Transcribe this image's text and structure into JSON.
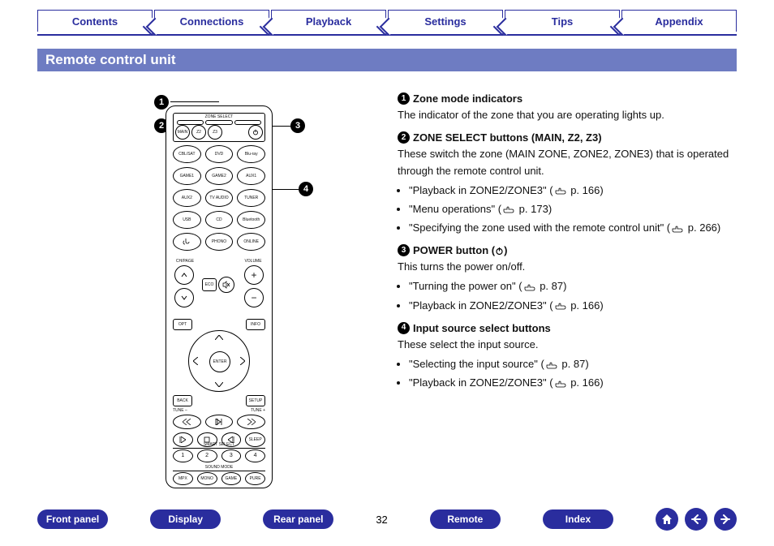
{
  "tabs": [
    "Contents",
    "Connections",
    "Playback",
    "Settings",
    "Tips",
    "Appendix"
  ],
  "title": "Remote control unit",
  "callouts": {
    "c1": "1",
    "c2": "2",
    "c3": "3",
    "c4": "4"
  },
  "sections": [
    {
      "num": "1",
      "heading": "Zone mode indicators",
      "body": "The indicator of the zone that you are operating lights up.",
      "links": []
    },
    {
      "num": "2",
      "heading": "ZONE SELECT buttons (MAIN, Z2, Z3)",
      "body": "These switch the zone (MAIN ZONE, ZONE2, ZONE3) that is operated through the remote control unit.",
      "links": [
        {
          "label": "\"Playback in ZONE2/ZONE3\"",
          "page": "p. 166"
        },
        {
          "label": "\"Menu operations\"",
          "page": "p. 173"
        },
        {
          "label": "\"Specifying the zone used with the remote control unit\"",
          "page": "p. 266"
        }
      ]
    },
    {
      "num": "3",
      "heading": "POWER button (",
      "heading_after": ")",
      "body": "This turns the power on/off.",
      "links": [
        {
          "label": "\"Turning the power on\"",
          "page": "p. 87"
        },
        {
          "label": "\"Playback in ZONE2/ZONE3\"",
          "page": "p. 166"
        }
      ]
    },
    {
      "num": "4",
      "heading": "Input source select buttons",
      "body": "These select the input source.",
      "links": [
        {
          "label": "\"Selecting the input source\"",
          "page": "p. 87"
        },
        {
          "label": "\"Playback in ZONE2/ZONE3\"",
          "page": "p. 166"
        }
      ]
    }
  ],
  "bottom_buttons": [
    "Front panel",
    "Display",
    "Rear panel"
  ],
  "page_number": "32",
  "bottom_buttons2": [
    "Remote",
    "Index"
  ],
  "remote_labels": {
    "zone_select": "ZONE SELECT",
    "main": "MAIN",
    "z2": "Z2",
    "z3": "Z3",
    "row1": [
      "CBL/SAT",
      "DVD",
      "Blu-ray"
    ],
    "row2": [
      "GAME1",
      "GAME2",
      "AUX1"
    ],
    "row3": [
      "AUX2",
      "TV AUDIO",
      "TUNER"
    ],
    "row4": [
      "USB",
      "CD",
      "Bluetooth"
    ],
    "row5": [
      "",
      "PHONO",
      "ONLINE MUSIC"
    ],
    "ch_page": "CH/PAGE",
    "volume": "VOLUME",
    "opt": "OPT",
    "eco": "ECO",
    "info": "INFO",
    "enter": "ENTER",
    "back": "BACK",
    "setup": "SETUP",
    "tune_minus": "TUNE –",
    "tune_plus": "TUNE +",
    "smart_select": "SMART SELECT",
    "sound_mode": "SOUND MODE",
    "ss": [
      "1",
      "2",
      "3",
      "4"
    ],
    "modes": [
      "MPX",
      "MONO",
      "GAME",
      "PURE"
    ]
  }
}
